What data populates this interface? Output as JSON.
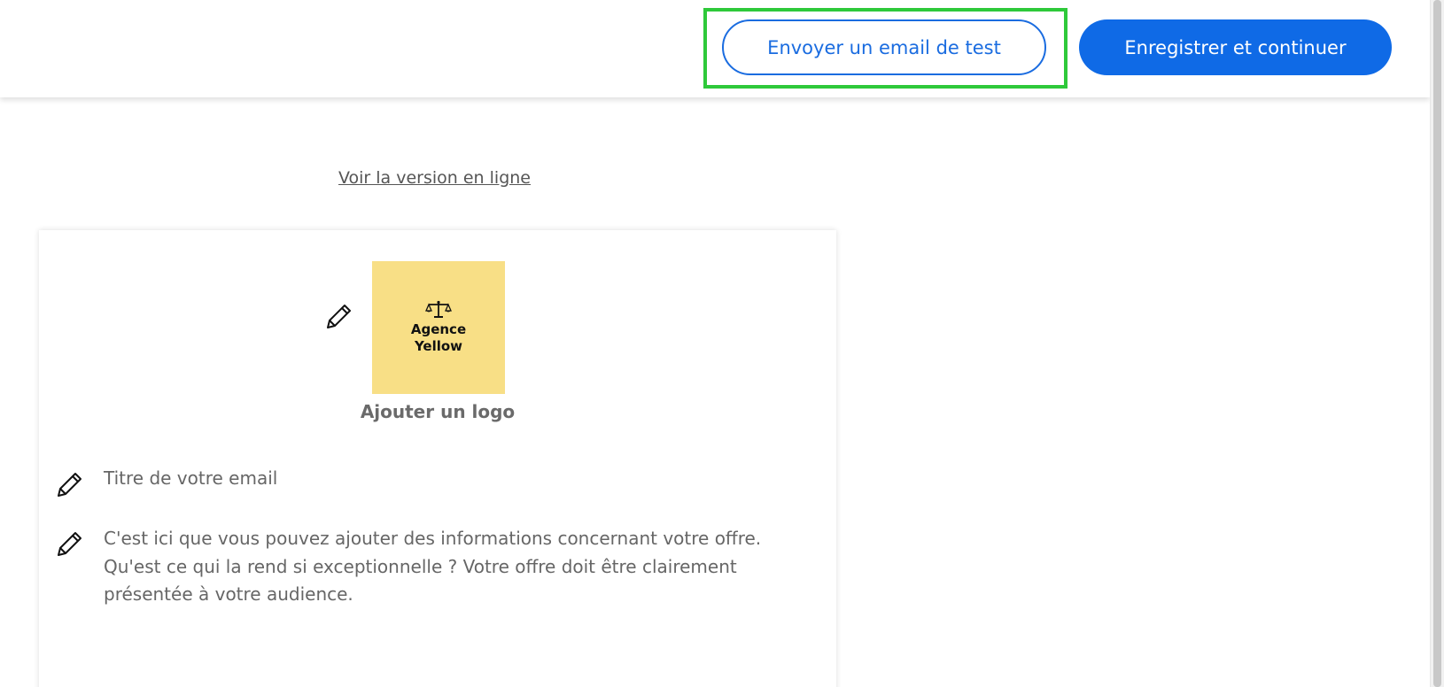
{
  "header": {
    "test_email_button": "Envoyer un email de test",
    "save_continue_button": "Enregistrer et continuer"
  },
  "content": {
    "online_version_link": "Voir la version en ligne",
    "logo": {
      "line1": "Agence",
      "line2": "Yellow",
      "icon": "scales-of-justice-icon"
    },
    "add_logo_label": "Ajouter un logo",
    "email_title": "Titre de votre email",
    "body_line1": "C'est ici que vous pouvez ajouter des informations concernant votre offre.",
    "body_line2": "Qu'est ce qui la rend si exceptionnelle ? Votre offre doit être clairement présentée à votre audience."
  },
  "colors": {
    "primary": "#0f6ae6",
    "highlight": "#2ec93a",
    "logo_bg": "#f8df86"
  },
  "icons": [
    "pencil-icon",
    "scales-of-justice-icon"
  ]
}
